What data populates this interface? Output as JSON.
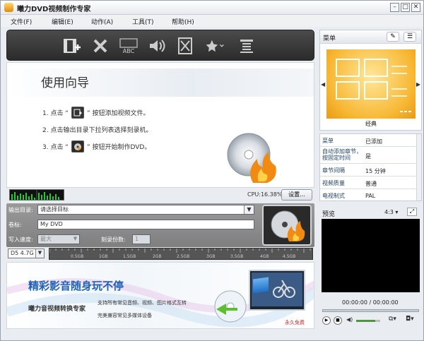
{
  "window": {
    "title": "曦力DVD视频制作专家",
    "controls": [
      "minimize",
      "maximize",
      "close"
    ]
  },
  "menubar": {
    "items": [
      "文件(F)",
      "编辑(E)",
      "动作(A)",
      "工具(T)",
      "帮助(H)"
    ]
  },
  "toolbar": {
    "icons": [
      "add-video-icon",
      "delete-icon",
      "subtitle-abc-icon",
      "audio-icon",
      "cut-icon",
      "effect-star-icon",
      "chapter-list-icon"
    ],
    "subtitle_label": "ABC"
  },
  "guide": {
    "title": "使用向导",
    "step1_prefix": "1. 点击 “",
    "step1_suffix": "” 按钮添加视频文件。",
    "step2": "2. 点击输出目录下拉列表选择刻录机。",
    "step3_prefix": "3. 点击 “",
    "step3_suffix": "” 按钮开始制作DVD。"
  },
  "status": {
    "cpu": "CPU:16.38%",
    "settings_button": "设置..."
  },
  "output": {
    "dir_label": "输出目录:",
    "dir_value": "请选择目标",
    "volume_label": "卷标:",
    "volume_value": "My DVD",
    "speed_label": "写入速度:",
    "speed_value": "最大",
    "copies_label": "刻录份数:",
    "copies_value": "1"
  },
  "disc": {
    "type": "D5 4.7G",
    "ruler_ticks": [
      "0.5GB",
      "1GB",
      "1.5GB",
      "2GB",
      "2.5GB",
      "3GB",
      "3.5GB",
      "4GB",
      "4.5GB"
    ]
  },
  "banner": {
    "headline": "精彩影音随身玩不停",
    "product": "曦力音视频转换专家",
    "line1": "支持所有常见音频、视频、图片格式互转",
    "line2": "完美兼容常见多媒体设备",
    "tag": "永久免费"
  },
  "menu_panel": {
    "title": "菜单",
    "preview_label": "经典"
  },
  "properties": [
    {
      "key": "菜单",
      "value": "已添加"
    },
    {
      "key": "自动添加章节，按固定时间",
      "value": "是"
    },
    {
      "key": "章节间隔",
      "value": "15 分钟"
    },
    {
      "key": "视频质量",
      "value": "普通"
    },
    {
      "key": "电视制式",
      "value": "PAL"
    }
  ],
  "preview": {
    "title": "预览",
    "aspect": "4:3",
    "time": "00:00:00 / 00:00:00"
  },
  "colors": {
    "accent": "#f0a81c",
    "toolbar_bg": "#333333",
    "panel_bg": "#e9ecf0"
  }
}
